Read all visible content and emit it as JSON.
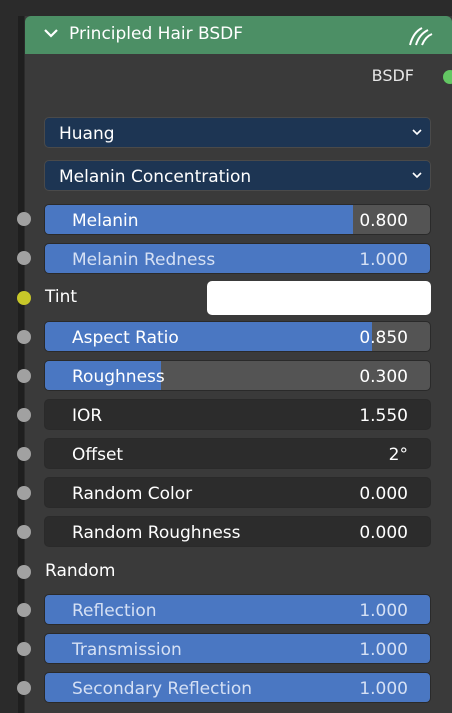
{
  "node": {
    "title": "Principled Hair BSDF",
    "output_label": "BSDF",
    "accent_color": "#4c8f65"
  },
  "model_dropdown": {
    "value": "Huang"
  },
  "parametrization_dropdown": {
    "value": "Melanin Concentration"
  },
  "inputs": {
    "melanin": {
      "label": "Melanin",
      "value": "0.800",
      "fill_fraction": 0.8
    },
    "melanin_redness": {
      "label": "Melanin Redness",
      "value": "1.000",
      "fill_fraction": 1.0
    },
    "tint": {
      "label": "Tint",
      "color": "#ffffff"
    },
    "aspect_ratio": {
      "label": "Aspect Ratio",
      "value": "0.850",
      "fill_fraction": 0.85
    },
    "roughness": {
      "label": "Roughness",
      "value": "0.300",
      "fill_fraction": 0.3
    },
    "ior": {
      "label": "IOR",
      "value": "1.550"
    },
    "offset": {
      "label": "Offset",
      "value": "2°"
    },
    "random_color": {
      "label": "Random Color",
      "value": "0.000"
    },
    "random_roughness": {
      "label": "Random Roughness",
      "value": "0.000"
    },
    "random": {
      "label": "Random"
    },
    "reflection": {
      "label": "Reflection",
      "value": "1.000",
      "fill_fraction": 1.0
    },
    "transmission": {
      "label": "Transmission",
      "value": "1.000",
      "fill_fraction": 1.0
    },
    "secondary_reflection": {
      "label": "Secondary Reflection",
      "value": "1.000",
      "fill_fraction": 1.0
    }
  },
  "icons": {
    "collapse": "chevron-down-icon",
    "hair": "hair-icon",
    "dropdown_arrow": "chevron-down-icon"
  }
}
